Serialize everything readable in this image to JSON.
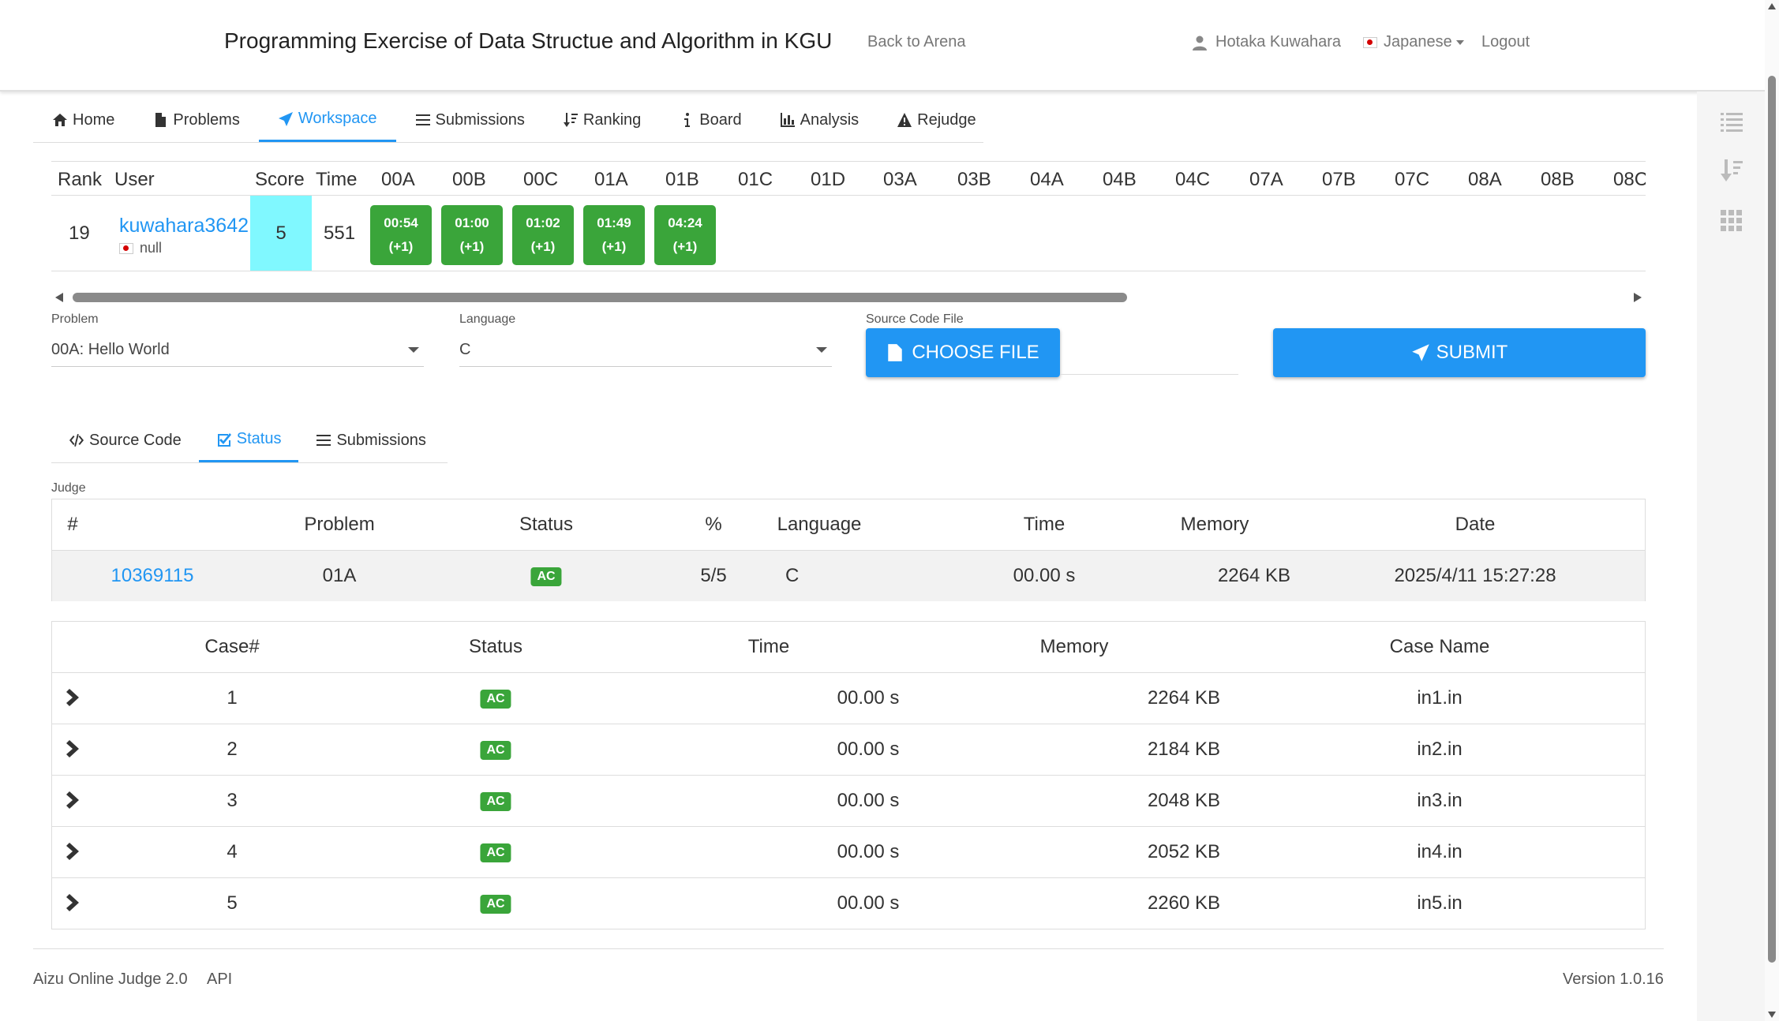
{
  "header": {
    "title": "Programming Exercise of Data Structue and Algorithm in KGU",
    "back_link": "Back to Arena",
    "user_name": "Hotaka Kuwahara",
    "language": "Japanese",
    "logout": "Logout"
  },
  "nav": {
    "tabs": [
      {
        "label": "Home",
        "icon": "home-icon"
      },
      {
        "label": "Problems",
        "icon": "file-icon"
      },
      {
        "label": "Workspace",
        "icon": "paper-plane-icon",
        "active": true
      },
      {
        "label": "Submissions",
        "icon": "list-icon"
      },
      {
        "label": "Ranking",
        "icon": "sort-icon"
      },
      {
        "label": "Board",
        "icon": "info-icon"
      },
      {
        "label": "Analysis",
        "icon": "bar-chart-icon"
      },
      {
        "label": "Rejudge",
        "icon": "warning-icon"
      }
    ]
  },
  "standings": {
    "headers": {
      "rank": "Rank",
      "user": "User",
      "score": "Score",
      "time": "Time"
    },
    "problems": [
      "00A",
      "00B",
      "00C",
      "01A",
      "01B",
      "01C",
      "01D",
      "03A",
      "03B",
      "04A",
      "04B",
      "04C",
      "07A",
      "07B",
      "07C",
      "08A",
      "08B",
      "08C"
    ],
    "row": {
      "rank": "19",
      "user": "kuwahara3642",
      "affiliation": "null",
      "score": "5",
      "time": "551",
      "cells": [
        {
          "time": "00:54",
          "penalty": "(+1)"
        },
        {
          "time": "01:00",
          "penalty": "(+1)"
        },
        {
          "time": "01:02",
          "penalty": "(+1)"
        },
        {
          "time": "01:49",
          "penalty": "(+1)"
        },
        {
          "time": "04:24",
          "penalty": "(+1)"
        }
      ]
    },
    "highlight_color": "#80f8ff",
    "solved_color": "#3aa53a"
  },
  "form": {
    "problem_label": "Problem",
    "problem_value": "00A: Hello World",
    "language_label": "Language",
    "language_value": "C",
    "file_label": "Source Code File",
    "choose_file": "CHOOSE FILE",
    "submit": "SUBMIT"
  },
  "subtabs": [
    {
      "label": "Source Code",
      "icon": "code-icon"
    },
    {
      "label": "Status",
      "icon": "check-square-icon",
      "active": true
    },
    {
      "label": "Submissions",
      "icon": "list-icon"
    }
  ],
  "judge": {
    "label": "Judge",
    "headers": [
      "#",
      "Problem",
      "Status",
      "%",
      "Language",
      "Time",
      "Memory",
      "Date"
    ],
    "row": {
      "id": "10369115",
      "problem": "01A",
      "status": "AC",
      "percent": "5/5",
      "language": "C",
      "time": "00.00 s",
      "memory": "2264 KB",
      "date": "2025/4/11 15:27:28"
    }
  },
  "cases": {
    "headers": [
      "Case#",
      "Status",
      "Time",
      "Memory",
      "Case Name"
    ],
    "rows": [
      {
        "num": "1",
        "status": "AC",
        "time": "00.00 s",
        "memory": "2264 KB",
        "name": "in1.in"
      },
      {
        "num": "2",
        "status": "AC",
        "time": "00.00 s",
        "memory": "2184 KB",
        "name": "in2.in"
      },
      {
        "num": "3",
        "status": "AC",
        "time": "00.00 s",
        "memory": "2048 KB",
        "name": "in3.in"
      },
      {
        "num": "4",
        "status": "AC",
        "time": "00.00 s",
        "memory": "2052 KB",
        "name": "in4.in"
      },
      {
        "num": "5",
        "status": "AC",
        "time": "00.00 s",
        "memory": "2260 KB",
        "name": "in5.in"
      }
    ]
  },
  "footer": {
    "left": "Aizu Online Judge 2.0",
    "api": "API",
    "version": "Version 1.0.16"
  },
  "colors": {
    "accent": "#2196f3",
    "ac_badge": "#3aa53a"
  }
}
